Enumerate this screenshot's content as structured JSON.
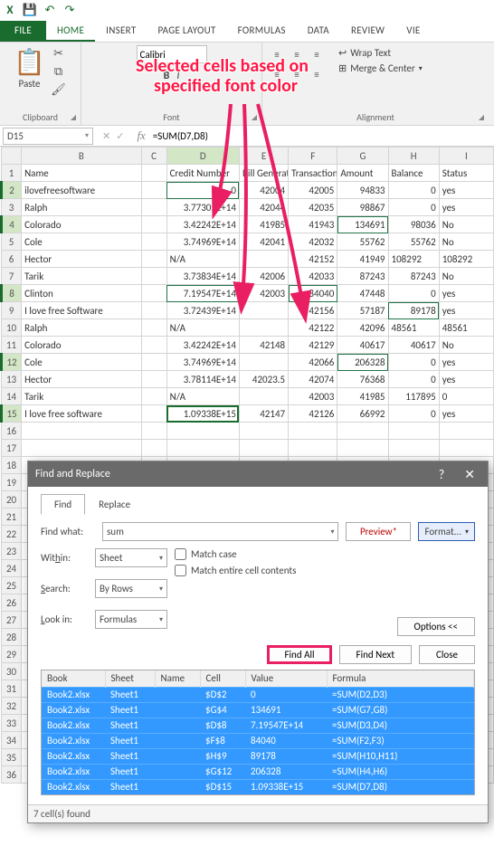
{
  "qat": {
    "excel_icon": "X",
    "save_icon": "💾",
    "undo_icon": "↶",
    "redo_icon": "↷"
  },
  "tabs": {
    "file": "FILE",
    "home": "HOME",
    "insert": "INSERT",
    "pagelayout": "PAGE LAYOUT",
    "formulas": "FORMULAS",
    "data": "DATA",
    "review": "REVIEW",
    "view": "VIE"
  },
  "ribbon": {
    "clipboard": {
      "paste": "Paste",
      "label": "Clipboard"
    },
    "font": {
      "name": "Calibri",
      "bold": "B",
      "italic": "I",
      "label": "Font"
    },
    "alignment": {
      "wrap": "Wrap Text",
      "merge": "Merge & Center",
      "label": "Alignment"
    }
  },
  "annotation": {
    "line1": "Selected cells based on",
    "line2": "specified font color"
  },
  "namebox": "D15",
  "fx": {
    "x": "✕",
    "check": "✓",
    "fx": "fx"
  },
  "formula": "=SUM(D7,D8)",
  "columns": [
    "",
    "B",
    "C",
    "D",
    "E",
    "F",
    "G",
    "H",
    "I"
  ],
  "headers": {
    "b": "Name",
    "c": "",
    "d": "Credit Number",
    "e": "Bill Generated",
    "f": "Transaction ID",
    "g": "Amount",
    "h": "Balance",
    "i": "Status"
  },
  "rows": [
    {
      "n": "1",
      "b": "Name",
      "c": "",
      "d": "Credit Number",
      "e": "Bill Generated",
      "f": "Transaction ID",
      "g": "Amount",
      "h": "Balance",
      "i": "Status",
      "hdr": true
    },
    {
      "n": "2",
      "b": "ilovefreesoftware",
      "c": "",
      "d": "0",
      "e": "42004",
      "f": "42005",
      "g": "94833",
      "h": "0",
      "i": "yes",
      "sel": true,
      "dred": true
    },
    {
      "n": "3",
      "b": "Ralph",
      "c": "",
      "d": "3.77305E+14",
      "e": "42044",
      "f": "42035",
      "g": "98867",
      "h": "0",
      "i": "yes"
    },
    {
      "n": "4",
      "b": "Colorado",
      "c": "",
      "d": "3.42242E+14",
      "e": "41985",
      "f": "41943",
      "g": "134691",
      "h": "98036",
      "i": "No",
      "sel": true,
      "gred": true
    },
    {
      "n": "5",
      "b": "Cole",
      "c": "",
      "d": "3.74969E+14",
      "e": "42041",
      "f": "42032",
      "g": "55762",
      "h": "55762",
      "i": "No"
    },
    {
      "n": "6",
      "b": "Hector",
      "c": "",
      "d": "N/A",
      "e": "",
      "f": "42152",
      "g": "41949",
      "h": "108292",
      "i": "108292"
    },
    {
      "n": "7",
      "b": "Tarik",
      "c": "",
      "d": "3.73834E+14",
      "e": "42006",
      "f": "42033",
      "g": "87243",
      "h": "87243",
      "i": "No"
    },
    {
      "n": "8",
      "b": "Clinton",
      "c": "",
      "d": "7.19547E+14",
      "e": "42003",
      "f": "84040",
      "g": "47448",
      "h": "0",
      "i": "yes",
      "sel": true,
      "dred": true,
      "fred": true
    },
    {
      "n": "9",
      "b": "I love free Software",
      "c": "",
      "d": "3.72439E+14",
      "e": "",
      "f": "42156",
      "g": "57187",
      "h": "89178",
      "i": "yes",
      "hred": true
    },
    {
      "n": "10",
      "b": "Ralph",
      "c": "",
      "d": "N/A",
      "e": "",
      "f": "42122",
      "g": "42096",
      "h": "48561",
      "i": "48561"
    },
    {
      "n": "11",
      "b": "Colorado",
      "c": "",
      "d": "3.42242E+14",
      "e": "42148",
      "f": "42129",
      "g": "40617",
      "h": "40617",
      "i": "No"
    },
    {
      "n": "12",
      "b": "Cole",
      "c": "",
      "d": "3.74969E+14",
      "e": "",
      "f": "42066",
      "g": "206328",
      "h": "0",
      "i": "yes",
      "sel": true,
      "gred": true
    },
    {
      "n": "13",
      "b": "Hector",
      "c": "",
      "d": "3.78114E+14",
      "e": "42023.5",
      "f": "42074",
      "g": "76368",
      "h": "0",
      "i": "yes"
    },
    {
      "n": "14",
      "b": "Tarik",
      "c": "",
      "d": "N/A",
      "e": "",
      "f": "42003",
      "g": "41985",
      "h": "117895",
      "i": "0"
    },
    {
      "n": "15",
      "b": "I love free software",
      "c": "",
      "d": "1.09338E+15",
      "e": "42147",
      "f": "42126",
      "g": "66992",
      "h": "0",
      "i": "yes",
      "sel": true,
      "dred": true,
      "active": true
    },
    {
      "n": "16"
    },
    {
      "n": "17"
    },
    {
      "n": "18"
    },
    {
      "n": "19"
    },
    {
      "n": "20"
    },
    {
      "n": "21"
    },
    {
      "n": "22"
    },
    {
      "n": "23"
    },
    {
      "n": "24"
    },
    {
      "n": "25"
    },
    {
      "n": "26"
    },
    {
      "n": "27"
    },
    {
      "n": "28"
    },
    {
      "n": "29"
    },
    {
      "n": "30"
    },
    {
      "n": "31"
    },
    {
      "n": "32"
    },
    {
      "n": "33"
    },
    {
      "n": "34"
    },
    {
      "n": "35"
    },
    {
      "n": "36"
    }
  ],
  "dialog": {
    "title": "Find and Replace",
    "tabs": {
      "find": "Find",
      "replace": "Replace"
    },
    "findwhat_label": "Find what:",
    "findwhat_value": "sum",
    "preview": "Preview*",
    "format": "Format...",
    "within_label": "Within:",
    "within": "Sheet",
    "search_label": "Search:",
    "search": "By Rows",
    "lookin_label": "Look in:",
    "lookin": "Formulas",
    "matchcase": "Match case",
    "matchentire": "Match entire cell contents",
    "options": "Options <<",
    "findall": "Find All",
    "findnext": "Find Next",
    "close": "Close",
    "cols": {
      "book": "Book",
      "sheet": "Sheet",
      "name": "Name",
      "cell": "Cell",
      "value": "Value",
      "formula": "Formula"
    },
    "results": [
      {
        "book": "Book2.xlsx",
        "sheet": "Sheet1",
        "name": "",
        "cell": "$D$2",
        "value": "0",
        "formula": "=SUM(D2,D3)"
      },
      {
        "book": "Book2.xlsx",
        "sheet": "Sheet1",
        "name": "",
        "cell": "$G$4",
        "value": "134691",
        "formula": "=SUM(G7,G8)"
      },
      {
        "book": "Book2.xlsx",
        "sheet": "Sheet1",
        "name": "",
        "cell": "$D$8",
        "value": "7.19547E+14",
        "formula": "=SUM(D3,D4)"
      },
      {
        "book": "Book2.xlsx",
        "sheet": "Sheet1",
        "name": "",
        "cell": "$F$8",
        "value": "84040",
        "formula": "=SUM(F2,F3)"
      },
      {
        "book": "Book2.xlsx",
        "sheet": "Sheet1",
        "name": "",
        "cell": "$H$9",
        "value": "89178",
        "formula": "=SUM(H10,H11)"
      },
      {
        "book": "Book2.xlsx",
        "sheet": "Sheet1",
        "name": "",
        "cell": "$G$12",
        "value": "206328",
        "formula": "=SUM(H4,H6)"
      },
      {
        "book": "Book2.xlsx",
        "sheet": "Sheet1",
        "name": "",
        "cell": "$D$15",
        "value": "1.09338E+15",
        "formula": "=SUM(D7,D8)"
      }
    ],
    "status": "7 cell(s) found"
  }
}
